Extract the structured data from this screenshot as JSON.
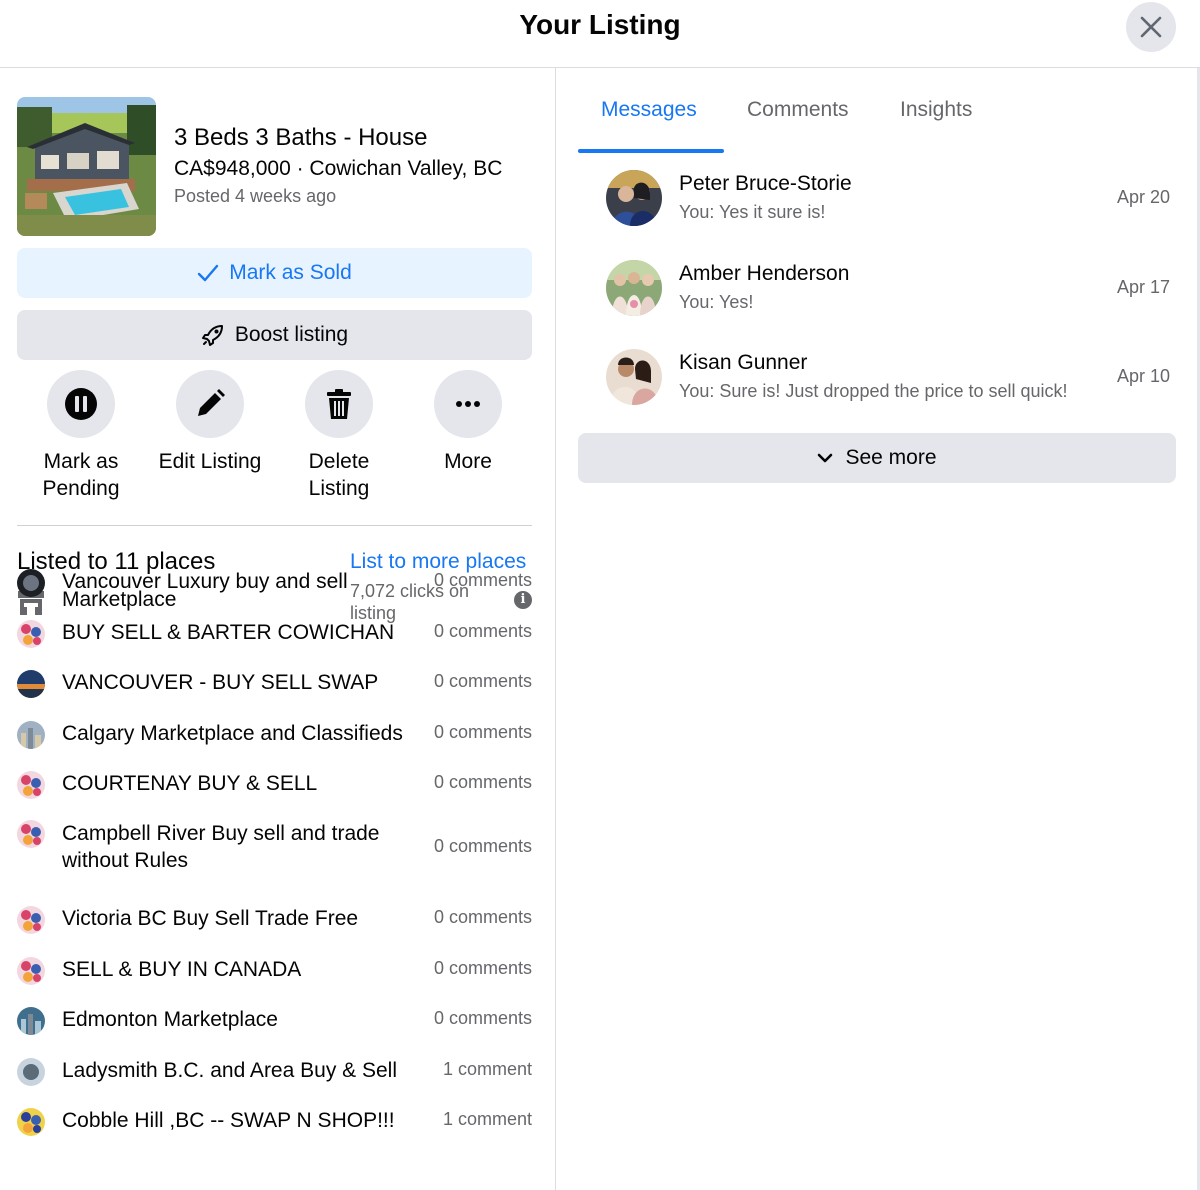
{
  "header": {
    "title": "Your Listing"
  },
  "listing": {
    "title": "3 Beds 3 Baths - House",
    "price_location": "CA$948,000 · Cowichan Valley, BC",
    "posted": "Posted 4 weeks ago"
  },
  "buttons": {
    "mark_sold": "Mark as Sold",
    "boost": "Boost listing"
  },
  "actions": [
    {
      "label_line1": "Mark as",
      "label_line2": "Pending",
      "icon": "pause-icon"
    },
    {
      "label_line1": "Edit Listing",
      "label_line2": "",
      "icon": "pencil-icon"
    },
    {
      "label_line1": "Delete",
      "label_line2": "Listing",
      "icon": "trash-icon"
    },
    {
      "label_line1": "More",
      "label_line2": "",
      "icon": "more-dots-icon"
    }
  ],
  "places": {
    "title": "Listed to 11 places",
    "more_link": "List to more places",
    "marketplace": {
      "name": "Marketplace",
      "clicks": "7,072 clicks on listing",
      "icon": "storefront-icon"
    },
    "groups": [
      {
        "name": "Vancouver Luxury buy and sell",
        "comments": "0 comments"
      },
      {
        "name": "BUY SELL & BARTER COWICHAN",
        "comments": "0 comments"
      },
      {
        "name": "VANCOUVER - BUY SELL SWAP",
        "comments": "0 comments"
      },
      {
        "name": "Calgary Marketplace and Classifieds",
        "comments": "0 comments"
      },
      {
        "name": "COURTENAY BUY & SELL",
        "comments": "0 comments"
      },
      {
        "name": "Campbell River Buy sell and trade without Rules",
        "comments": "0 comments"
      },
      {
        "name": "Victoria BC Buy Sell Trade Free",
        "comments": "0 comments"
      },
      {
        "name": "SELL & BUY IN CANADA",
        "comments": "0 comments"
      },
      {
        "name": "Edmonton Marketplace",
        "comments": "0 comments"
      },
      {
        "name": "Ladysmith B.C. and Area Buy & Sell",
        "comments": "1 comment"
      },
      {
        "name": "Cobble Hill ,BC -- SWAP N SHOP!!!",
        "comments": "1 comment"
      }
    ]
  },
  "tabs": [
    {
      "label": "Messages",
      "active": true
    },
    {
      "label": "Comments",
      "active": false
    },
    {
      "label": "Insights",
      "active": false
    }
  ],
  "messages": [
    {
      "name": "Peter Bruce-Storie",
      "preview": "You: Yes it sure is!",
      "date": "Apr 20"
    },
    {
      "name": "Amber Henderson",
      "preview": "You: Yes!",
      "date": "Apr 17"
    },
    {
      "name": "Kisan Gunner",
      "preview": "You: Sure is! Just dropped the price to sell quick!",
      "date": "Apr 10"
    }
  ],
  "see_more": "See more",
  "colors": {
    "accent": "#1877f2",
    "button_gray": "#e4e6eb",
    "accent_light": "#e7f3ff",
    "secondary_text": "#65676b"
  }
}
